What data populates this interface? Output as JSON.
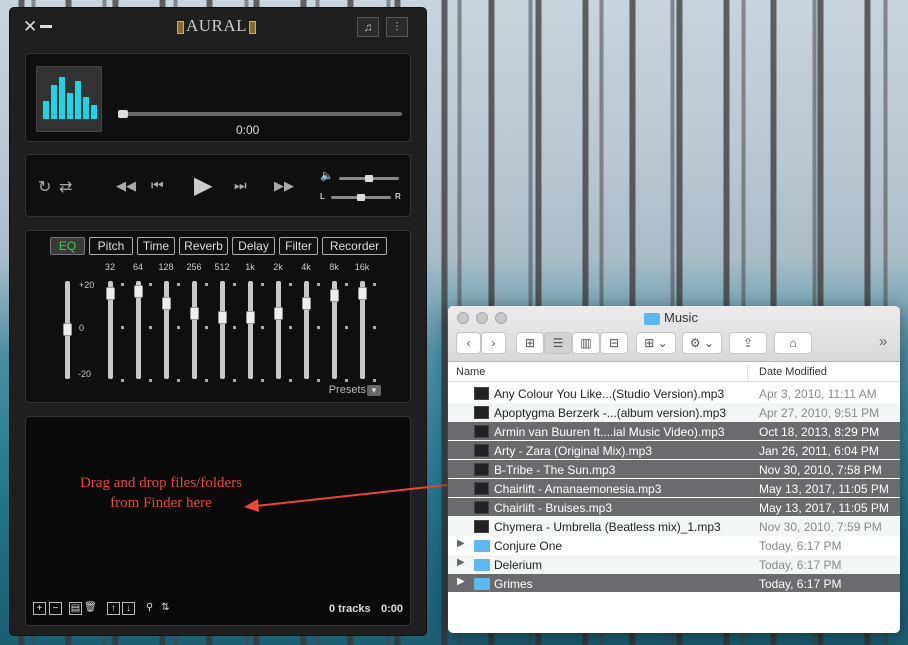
{
  "aural": {
    "title": "AURAL",
    "close_glyph": "✕",
    "now_playing": {
      "time": "0:00",
      "seek_progress": 0
    },
    "volume": {
      "level": 0.5,
      "balance_left_label": "L",
      "balance_right_label": "R",
      "balance": 0.5
    },
    "effects_tabs": [
      {
        "label": "EQ",
        "active": true
      },
      {
        "label": "Pitch"
      },
      {
        "label": "Time"
      },
      {
        "label": "Reverb"
      },
      {
        "label": "Delay"
      },
      {
        "label": "Filter"
      },
      {
        "label": "Recorder"
      }
    ],
    "eq": {
      "frequencies": [
        "32",
        "64",
        "128",
        "256",
        "512",
        "1k",
        "2k",
        "4k",
        "8k",
        "16k"
      ],
      "db_labels": [
        "+20",
        "0",
        "-20"
      ],
      "presets_label": "Presets"
    },
    "playlist": {
      "hint_line1": "Drag and drop files/folders",
      "hint_line2": "from Finder here",
      "tracks_label": "0 tracks",
      "duration": "0:00"
    }
  },
  "finder": {
    "title": "Music",
    "columns": {
      "name": "Name",
      "date": "Date Modified"
    },
    "rows": [
      {
        "name": "Any Colour You Like...(Studio Version).mp3",
        "date": "Apr 3, 2010, 11:11 AM",
        "type": "file",
        "selected": false
      },
      {
        "name": "Apoptygma Berzerk -...(album version).mp3",
        "date": "Apr 27, 2010, 9:51 PM",
        "type": "file",
        "selected": false
      },
      {
        "name": "Armin van Buuren ft....ial Music Video).mp3",
        "date": "Oct 18, 2013, 8:29 PM",
        "type": "file",
        "selected": true
      },
      {
        "name": "Arty - Zara (Original Mix).mp3",
        "date": "Jan 26, 2011, 6:04 PM",
        "type": "file",
        "selected": true
      },
      {
        "name": "B-Tribe - The Sun.mp3",
        "date": "Nov 30, 2010, 7:58 PM",
        "type": "file",
        "selected": true
      },
      {
        "name": "Chairlift - Amanaemonesia.mp3",
        "date": "May 13, 2017, 11:05 PM",
        "type": "file",
        "selected": true
      },
      {
        "name": "Chairlift - Bruises.mp3",
        "date": "May 13, 2017, 11:05 PM",
        "type": "file",
        "selected": true
      },
      {
        "name": "Chymera - Umbrella (Beatless mix)_1.mp3",
        "date": "Nov 30, 2010, 7:59 PM",
        "type": "file",
        "selected": false
      },
      {
        "name": "Conjure One",
        "date": "Today, 6:17 PM",
        "type": "folder",
        "selected": false
      },
      {
        "name": "Delerium",
        "date": "Today, 6:17 PM",
        "type": "folder",
        "selected": false
      },
      {
        "name": "Grimes",
        "date": "Today, 6:17 PM",
        "type": "folder",
        "selected": true
      }
    ],
    "disclosure_glyph": "▶",
    "overflow_glyph": "»"
  },
  "colors": {
    "eq_active": "#3bd14a",
    "hint": "#e8453c",
    "art_bars": "#1fd2e4",
    "finder_selection": "#6b6b6d",
    "folder": "#5eb7f0"
  }
}
